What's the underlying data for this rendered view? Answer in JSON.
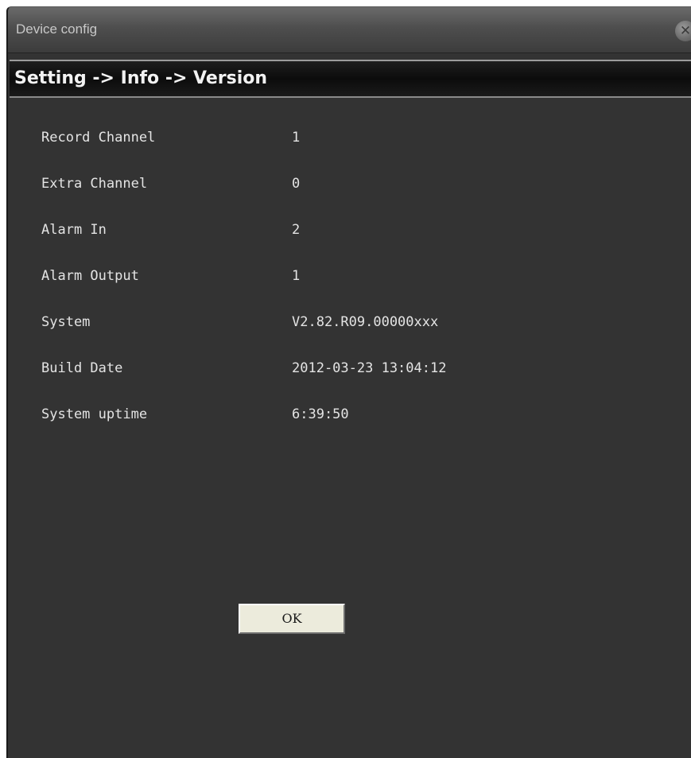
{
  "window": {
    "title": "Device config",
    "close_icon": "close-icon"
  },
  "breadcrumb": "Setting -> Info -> Version",
  "info": [
    {
      "label": "Record Channel",
      "value": "1"
    },
    {
      "label": "Extra Channel",
      "value": "0"
    },
    {
      "label": "Alarm In",
      "value": "2"
    },
    {
      "label": "Alarm Output",
      "value": "1"
    },
    {
      "label": "System",
      "value": "V2.82.R09.00000xxx"
    },
    {
      "label": "Build Date",
      "value": "2012-03-23 13:04:12"
    },
    {
      "label": "System uptime",
      "value": "6:39:50"
    }
  ],
  "actions": {
    "ok_label": "OK"
  }
}
